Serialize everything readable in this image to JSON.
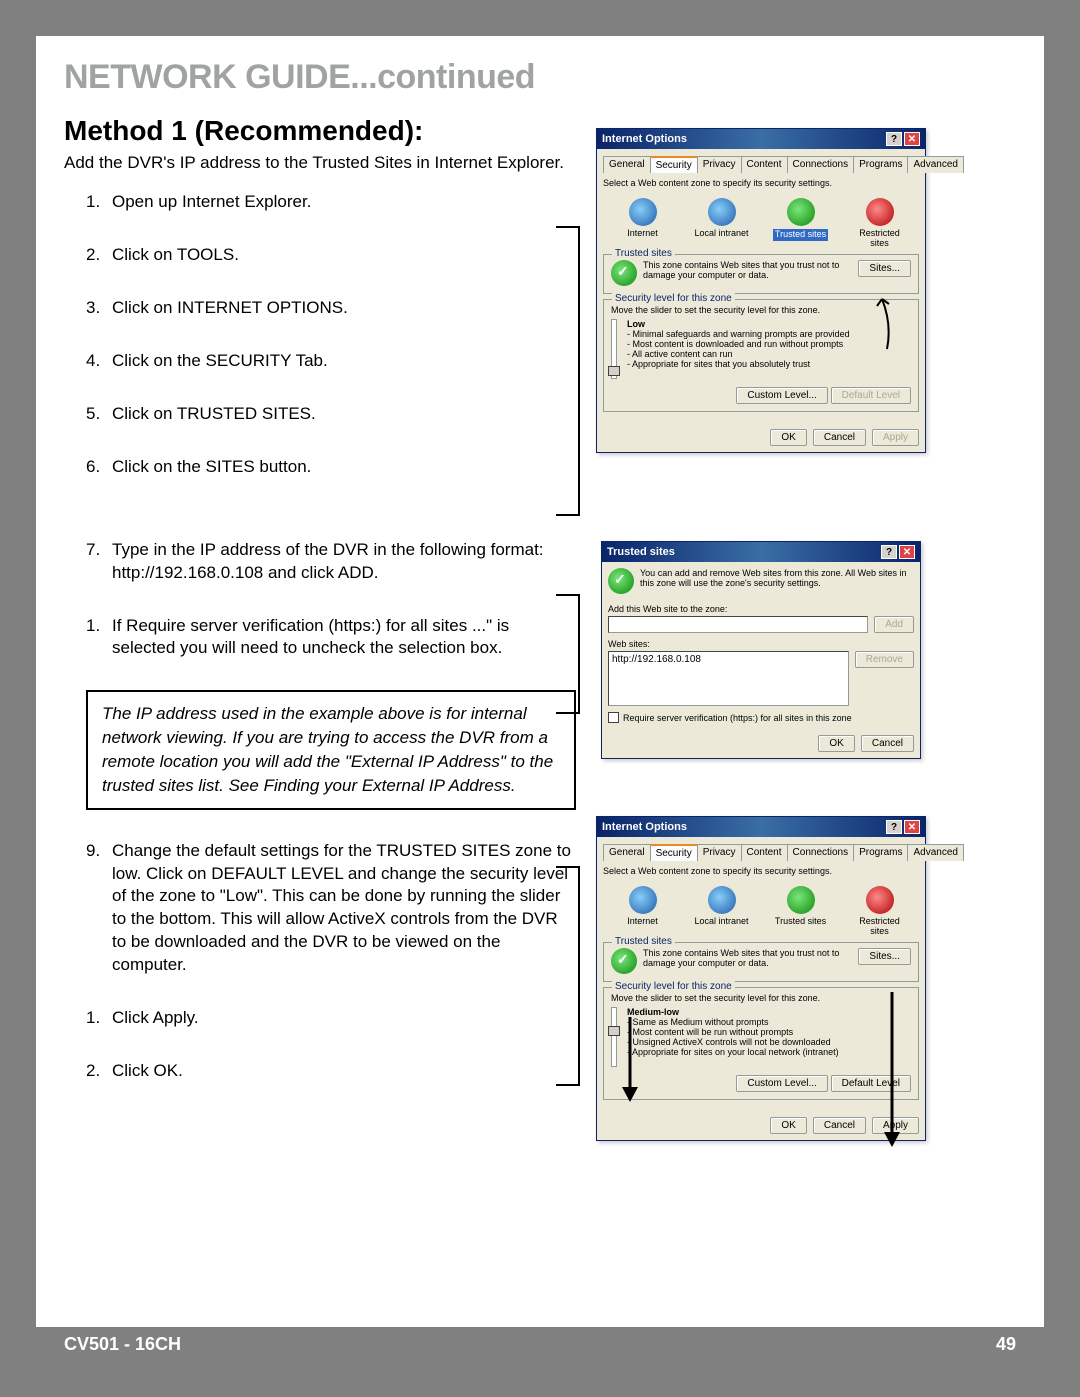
{
  "section_title": "NETWORK GUIDE...continued",
  "method_title": "Method 1 (Recommended):",
  "subtitle": "Add the DVR's IP address to the Trusted Sites in Internet Explorer.",
  "steps": [
    "Open up Internet Explorer.",
    "Click on TOOLS.",
    "Click on INTERNET OPTIONS.",
    "Click on the SECURITY Tab.",
    "Click on TRUSTED SITES.",
    "Click on the SITES button.",
    "Type in the IP address of the DVR in the following format: http://192.168.0.108 and click ADD.",
    "If Require server verification (https:) for all sites ...\" is selected you will need to uncheck the selection box.",
    "Change the default settings for the TRUSTED SITES zone to low. Click on DEFAULT LEVEL and change the security level of the zone to \"Low\". This can be done by running the slider to the bottom. This will allow ActiveX controls from the DVR to be downloaded and the DVR to be viewed on the computer.",
    "Click Apply.",
    "Click OK."
  ],
  "note": "The IP address used in the example above is for internal network viewing. If you are trying to access the DVR from a remote location you will add the \"External IP Address\" to the trusted sites list. See Finding your External IP Address.",
  "footer": {
    "left": "CV501 - 16CH",
    "right": "49"
  },
  "dialog1": {
    "title": "Internet Options",
    "tabs": [
      "General",
      "Security",
      "Privacy",
      "Content",
      "Connections",
      "Programs",
      "Advanced"
    ],
    "active_tab": "Security",
    "zone_prompt": "Select a Web content zone to specify its security settings.",
    "zones": [
      "Internet",
      "Local intranet",
      "Trusted sites",
      "Restricted sites"
    ],
    "selected_zone": "Trusted sites",
    "zone_name": "Trusted sites",
    "zone_desc": "This zone contains Web sites that you trust not to damage your computer or data.",
    "sites_btn": "Sites...",
    "sec_legend": "Security level for this zone",
    "sec_instruct": "Move the slider to set the security level for this zone.",
    "level_name": "Low",
    "level_bullets": [
      "- Minimal safeguards and warning prompts are provided",
      "- Most content is downloaded and run without prompts",
      "- All active content can run",
      "- Appropriate for sites that you absolutely trust"
    ],
    "custom_btn": "Custom Level...",
    "default_btn": "Default Level",
    "ok": "OK",
    "cancel": "Cancel",
    "apply": "Apply"
  },
  "dialog2": {
    "title": "Trusted sites",
    "instruct": "You can add and remove Web sites from this zone. All Web sites in this zone will use the zone's security settings.",
    "add_label": "Add this Web site to the zone:",
    "add_value": "",
    "add_btn": "Add",
    "list_label": "Web sites:",
    "list_item": "http://192.168.0.108",
    "remove_btn": "Remove",
    "checkbox": "Require server verification (https:) for all sites in this zone",
    "ok": "OK",
    "cancel": "Cancel"
  },
  "dialog3": {
    "title": "Internet Options",
    "tabs": [
      "General",
      "Security",
      "Privacy",
      "Content",
      "Connections",
      "Programs",
      "Advanced"
    ],
    "active_tab": "Security",
    "zone_prompt": "Select a Web content zone to specify its security settings.",
    "zones": [
      "Internet",
      "Local intranet",
      "Trusted sites",
      "Restricted sites"
    ],
    "zone_name": "Trusted sites",
    "zone_desc": "This zone contains Web sites that you trust not to damage your computer or data.",
    "sites_btn": "Sites...",
    "sec_legend": "Security level for this zone",
    "sec_instruct": "Move the slider to set the security level for this zone.",
    "level_name": "Medium-low",
    "level_bullets": [
      "- Same as Medium without prompts",
      "- Most content will be run without prompts",
      "- Unsigned ActiveX controls will not be downloaded",
      "- Appropriate for sites on your local network (intranet)"
    ],
    "custom_btn": "Custom Level...",
    "default_btn": "Default Level",
    "ok": "OK",
    "cancel": "Cancel",
    "apply": "Apply"
  }
}
